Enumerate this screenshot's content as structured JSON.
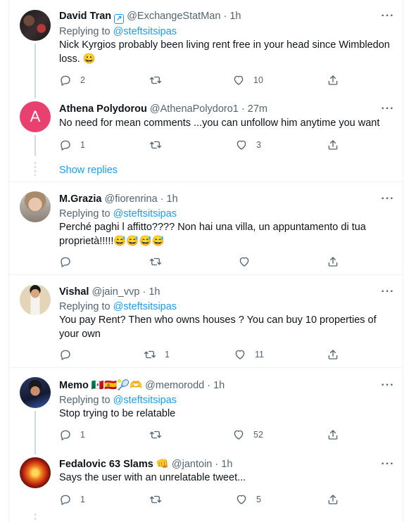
{
  "tweets": [
    {
      "name": "David Tran",
      "badge_icon": "link-arrow-icon",
      "handle": "@ExchangeStatMan",
      "sep": "·",
      "time": "1h",
      "replying_prefix": "Replying to ",
      "replying_handle": "@steftsitsipas",
      "text": "Nick Kyrgios probably been living rent free in your head since Wimbledon loss. 😀",
      "replies": "2",
      "retweets": "",
      "likes": "10"
    },
    {
      "name": "Athena Polydorou",
      "handle": "@AthenaPolydoro1",
      "sep": "·",
      "time": "27m",
      "avatar_letter": "A",
      "avatar_color": "#e8416f",
      "text": "No need for mean comments ...you can unfollow him anytime you want",
      "replies": "1",
      "retweets": "",
      "likes": "3"
    },
    {
      "name": "M.Grazia",
      "handle": "@fiorenrina",
      "sep": "·",
      "time": "1h",
      "replying_prefix": "Replying to ",
      "replying_handle": "@steftsitsipas",
      "text": "Perché paghi l affitto???? Non hai una villa, un appuntamento di tua proprietà!!!!!😅😅😅😅",
      "replies": "",
      "retweets": "",
      "likes": ""
    },
    {
      "name": "Vishal",
      "handle": "@jain_vvp",
      "sep": "·",
      "time": "1h",
      "replying_prefix": "Replying to ",
      "replying_handle": "@steftsitsipas",
      "text": "You pay Rent? Then who owns houses ? You can buy 10 properties of your own",
      "replies": "",
      "retweets": "1",
      "likes": "11"
    },
    {
      "name": "Memo 🇲🇽🇪🇸🎾🫶",
      "handle": "@memorodd",
      "sep": "·",
      "time": "1h",
      "replying_prefix": "Replying to ",
      "replying_handle": "@steftsitsipas",
      "text": "Stop trying to be relatable",
      "replies": "1",
      "retweets": "",
      "likes": "52"
    },
    {
      "name": "Fedalovic 63 Slams 👊",
      "handle": "@jantoin",
      "sep": "·",
      "time": "1h",
      "text": "Says the user with an unrelatable tweet...",
      "replies": "1",
      "retweets": "",
      "likes": "5"
    }
  ],
  "show_replies": "Show replies",
  "more_glyph": "···",
  "colors": {
    "accent": "#1d9bf0",
    "muted": "#536471",
    "border": "#eff3f4"
  }
}
